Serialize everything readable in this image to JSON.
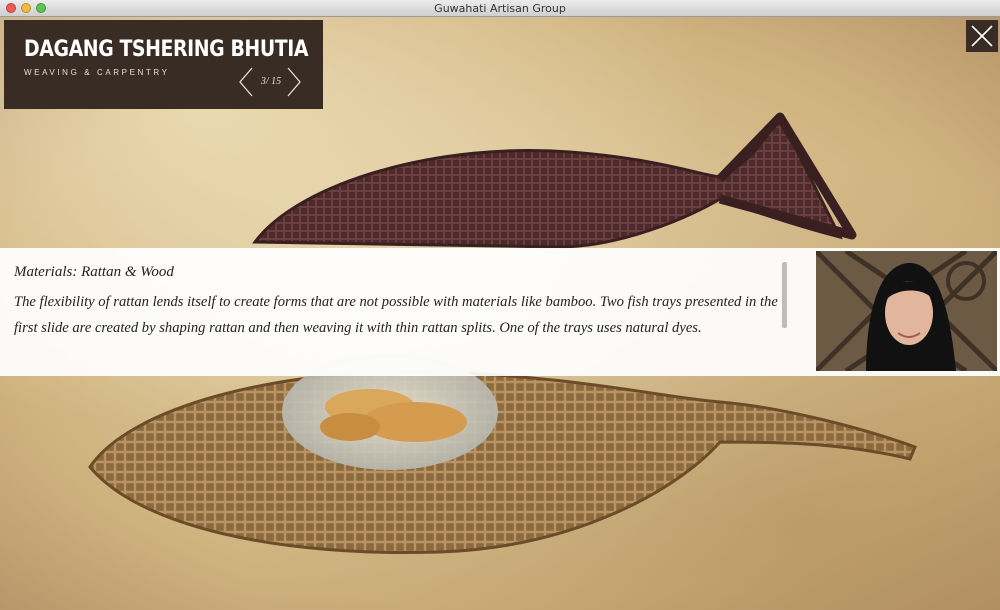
{
  "window": {
    "title": "Guwahati Artisan Group"
  },
  "artisan": {
    "name": "DAGANG TSHERING BHUTIA",
    "craft": "WEAVING & CARPENTRY"
  },
  "pager": {
    "label": "3/ 15"
  },
  "info": {
    "heading": "Materials: Rattan & Wood",
    "body": "The flexibility of rattan lends itself to create forms that are not possible with materials like bamboo. Two fish trays presented in the first slide are created by shaping rattan and then weaving it with thin rattan splits. One of the trays uses natural dyes."
  },
  "icons": {
    "prev": "chevron-left-icon",
    "next": "chevron-right-icon",
    "close": "close-icon"
  },
  "colors": {
    "panel": "#382c24",
    "background": "#d9c49a",
    "band": "#ffffff"
  }
}
